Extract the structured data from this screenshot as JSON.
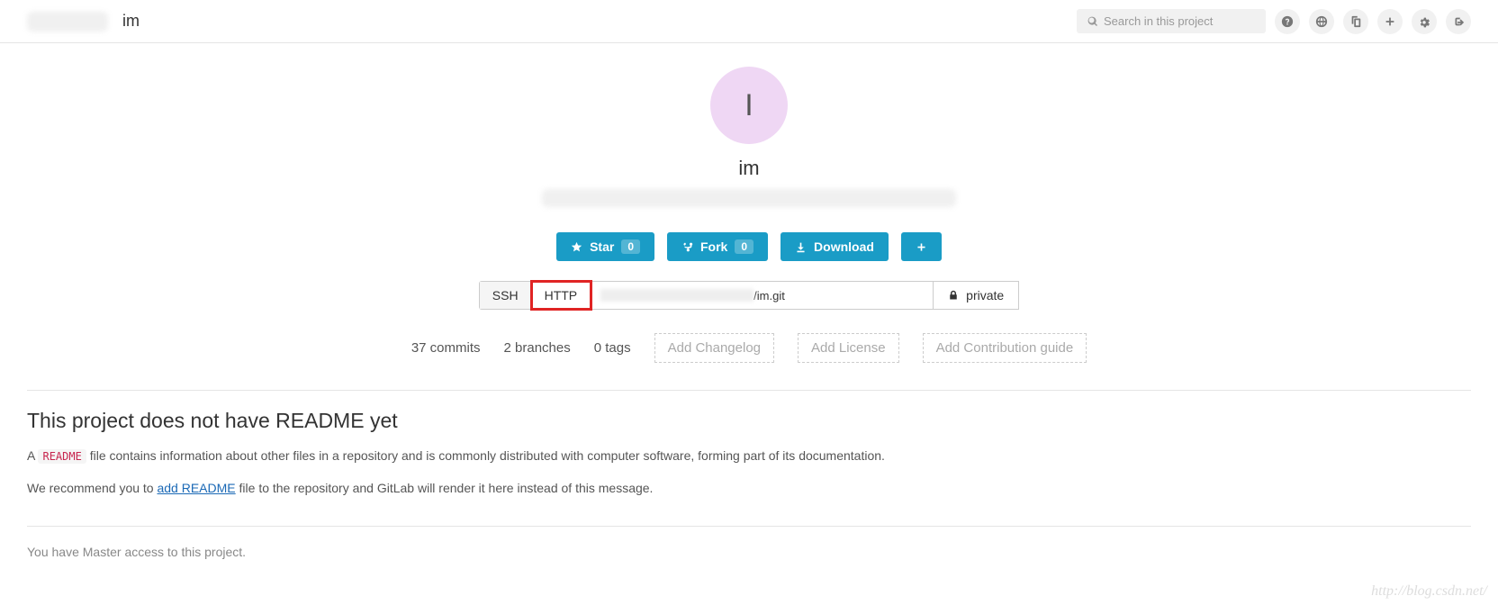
{
  "header": {
    "project_name": "im",
    "search_placeholder": "Search in this project"
  },
  "avatar_letter": "I",
  "project": {
    "name": "im"
  },
  "actions": {
    "star": {
      "label": "Star",
      "count": "0"
    },
    "fork": {
      "label": "Fork",
      "count": "0"
    },
    "download": {
      "label": "Download"
    }
  },
  "clone": {
    "ssh_label": "SSH",
    "http_label": "HTTP",
    "url_suffix": "/im.git",
    "visibility": "private"
  },
  "stats": {
    "commits": "37 commits",
    "branches": "2 branches",
    "tags": "0 tags"
  },
  "suggestions": {
    "changelog": "Add Changelog",
    "license": "Add License",
    "contribution": "Add Contribution guide"
  },
  "readme": {
    "heading": "This project does not have README yet",
    "line1_a": "A ",
    "code": "README",
    "line1_b": " file contains information about other files in a repository and is commonly distributed with computer software, forming part of its documentation.",
    "line2_a": "We recommend you to ",
    "link_text": "add README",
    "line2_b": " file to the repository and GitLab will render it here instead of this message."
  },
  "access_note": "You have Master access to this project.",
  "watermark": "http://blog.csdn.net/"
}
